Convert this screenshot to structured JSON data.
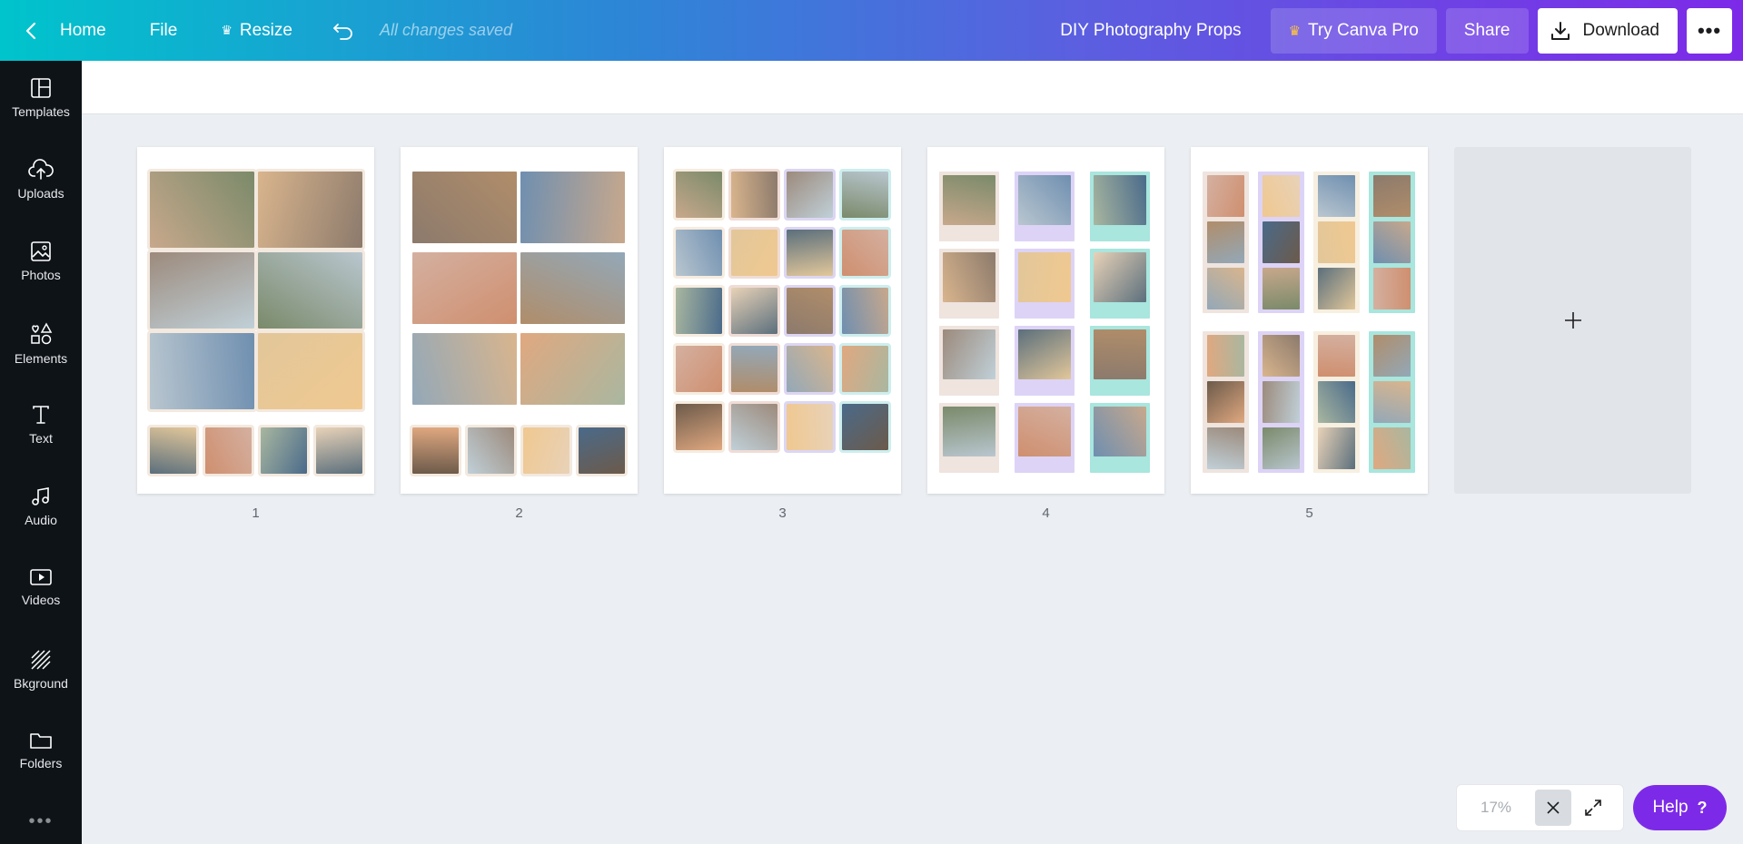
{
  "topbar": {
    "home_label": "Home",
    "file_label": "File",
    "resize_label": "Resize",
    "saved_status": "All changes saved",
    "design_title": "DIY Photography Props",
    "try_pro_label": "Try Canva Pro",
    "share_label": "Share",
    "download_label": "Download",
    "more_label": "•••"
  },
  "sidebar": {
    "items": [
      {
        "label": "Templates",
        "icon": "templates-icon"
      },
      {
        "label": "Uploads",
        "icon": "upload-icon"
      },
      {
        "label": "Photos",
        "icon": "photo-icon"
      },
      {
        "label": "Elements",
        "icon": "elements-icon"
      },
      {
        "label": "Text",
        "icon": "text-icon"
      },
      {
        "label": "Audio",
        "icon": "music-icon"
      },
      {
        "label": "Videos",
        "icon": "video-icon"
      },
      {
        "label": "Bkground",
        "icon": "background-icon"
      },
      {
        "label": "Folders",
        "icon": "folder-icon"
      }
    ],
    "more_label": "•••"
  },
  "pages": [
    {
      "number": "1"
    },
    {
      "number": "2"
    },
    {
      "number": "3"
    },
    {
      "number": "4"
    },
    {
      "number": "5"
    }
  ],
  "add_page": {
    "symbol": "+"
  },
  "zoom": {
    "value": "17%"
  },
  "help": {
    "label": "Help",
    "symbol": "?"
  },
  "colors": {
    "accent_purple": "#7d2ae8",
    "gradient_start": "#00c4cc",
    "gradient_end": "#7d2ae8",
    "sidebar_bg": "#0e1318",
    "canvas_bg": "#ebeef2",
    "crown": "#ffc53d"
  }
}
